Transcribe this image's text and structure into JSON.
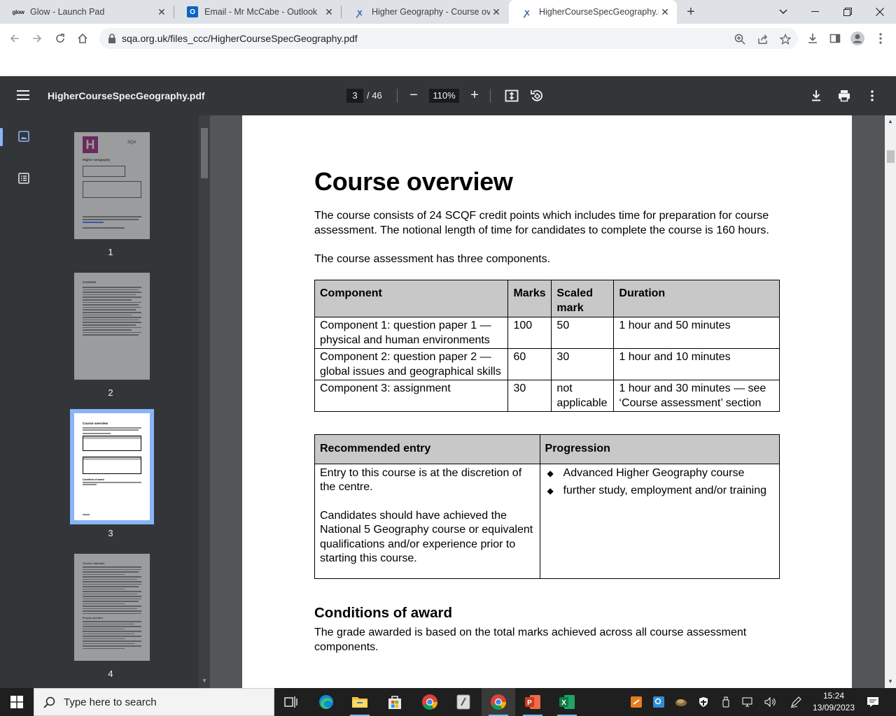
{
  "browser": {
    "tabs": [
      {
        "title": "Glow - Launch Pad",
        "icon": "glow-icon",
        "favicon_text": "glow",
        "active": false
      },
      {
        "title": "Email - Mr McCabe - Outlook",
        "icon": "outlook-icon",
        "favicon_text": "O",
        "active": false
      },
      {
        "title": "Higher Geography - Course overv",
        "icon": "sqa-icon",
        "active": false
      },
      {
        "title": "HigherCourseSpecGeography.pd",
        "icon": "sqa-icon",
        "active": true
      }
    ],
    "url": "sqa.org.uk/files_ccc/HigherCourseSpecGeography.pdf"
  },
  "pdf_toolbar": {
    "filename": "HigherCourseSpecGeography.pdf",
    "current_page": "3",
    "total_pages": "/ 46",
    "zoom": "110%"
  },
  "thumbnails": {
    "items": [
      {
        "number": "1",
        "current": false
      },
      {
        "number": "2",
        "current": false
      },
      {
        "number": "3",
        "current": true
      },
      {
        "number": "4",
        "current": false
      }
    ],
    "page1_text": {
      "logo_letter": "H",
      "brand": "SQA",
      "doc_title": "Higher Geography"
    },
    "page2_text": {
      "contents": "Contents"
    },
    "page3_text": {
      "title": "Course overview",
      "section": "Conditions of award"
    },
    "page4_text": {
      "title": "Course rationale",
      "section": "Purpose and aims"
    }
  },
  "document": {
    "heading": "Course overview",
    "intro": "The course consists of 24 SCQF credit points which includes time for preparation for course assessment. The notional length of time for candidates to complete the course is 160 hours.",
    "components_intro": "The course assessment has three components.",
    "components_table": {
      "headers": [
        "Component",
        "Marks",
        "Scaled mark",
        "Duration"
      ],
      "rows": [
        [
          "Component 1: question paper 1 — physical and human environments",
          "100",
          "50",
          "1 hour and 50 minutes"
        ],
        [
          "Component 2: question paper 2 — global issues and geographical skills",
          "60",
          "30",
          "1 hour and 10 minutes"
        ],
        [
          "Component 3: assignment",
          "30",
          "not applicable",
          "1 hour and 30 minutes — see ‘Course assessment’ section"
        ]
      ]
    },
    "entry_table": {
      "headers": [
        "Recommended entry",
        "Progression"
      ],
      "entry_text_1": "Entry to this course is at the discretion of the centre.",
      "entry_text_2": "Candidates should have achieved the National 5 Geography course or equivalent qualifications and/or experience prior to starting this course.",
      "progression": [
        "Advanced Higher Geography course",
        "further study, employment and/or training"
      ]
    },
    "conditions_heading": "Conditions of award",
    "conditions_text": "The grade awarded is based on the total marks achieved across all course assessment components."
  },
  "taskbar": {
    "search_placeholder": "Type here to search",
    "time": "15:24",
    "date": "13/09/2023"
  },
  "colors": {
    "pdf_toolbar_bg": "#323639",
    "viewer_bg": "#525659",
    "table_header_bg": "#c8c8c8",
    "thumb_highlight": "#8ab4f8"
  }
}
